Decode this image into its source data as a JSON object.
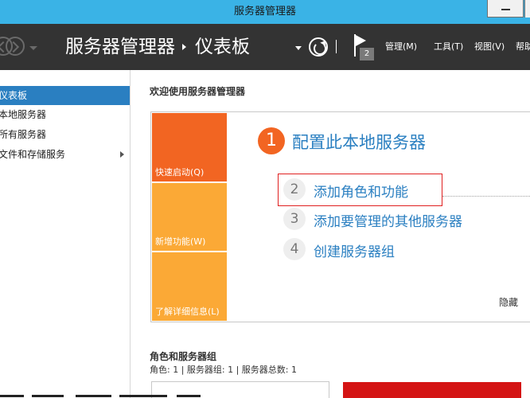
{
  "window": {
    "title": "服务器管理器"
  },
  "header": {
    "breadcrumb_root": "服务器管理器",
    "breadcrumb_current": "仪表板",
    "notification_count": "2",
    "menus": [
      {
        "label": "管理(M)"
      },
      {
        "label": "工具(T)"
      },
      {
        "label": "视图(V)"
      },
      {
        "label": "帮助"
      }
    ]
  },
  "sidebar": {
    "items": [
      {
        "label": "仪表板",
        "active": true
      },
      {
        "label": "本地服务器"
      },
      {
        "label": "所有服务器"
      },
      {
        "label": "文件和存储服务",
        "has_submenu": true
      }
    ]
  },
  "welcome": {
    "title": "欢迎使用服务器管理器",
    "tiles": [
      {
        "label": "快速启动(Q)"
      },
      {
        "label": "新增功能(W)"
      },
      {
        "label": "了解详细信息(L)"
      }
    ],
    "steps": [
      {
        "num": "1",
        "label": "配置此本地服务器"
      },
      {
        "num": "2",
        "label": "添加角色和功能"
      },
      {
        "num": "3",
        "label": "添加要管理的其他服务器"
      },
      {
        "num": "4",
        "label": "创建服务器组"
      }
    ],
    "hide_label": "隐藏"
  },
  "roles": {
    "title": "角色和服务器组",
    "summary": "角色: 1 | 服务器组: 1 | 服务器总数: 1"
  },
  "colors": {
    "titlebar": "#3ab3e6",
    "header": "#333333",
    "accent": "#2a7fc1",
    "tile_primary": "#f26522",
    "tile_secondary": "#fba936",
    "highlight": "#e02020",
    "alert_card": "#d41414"
  }
}
